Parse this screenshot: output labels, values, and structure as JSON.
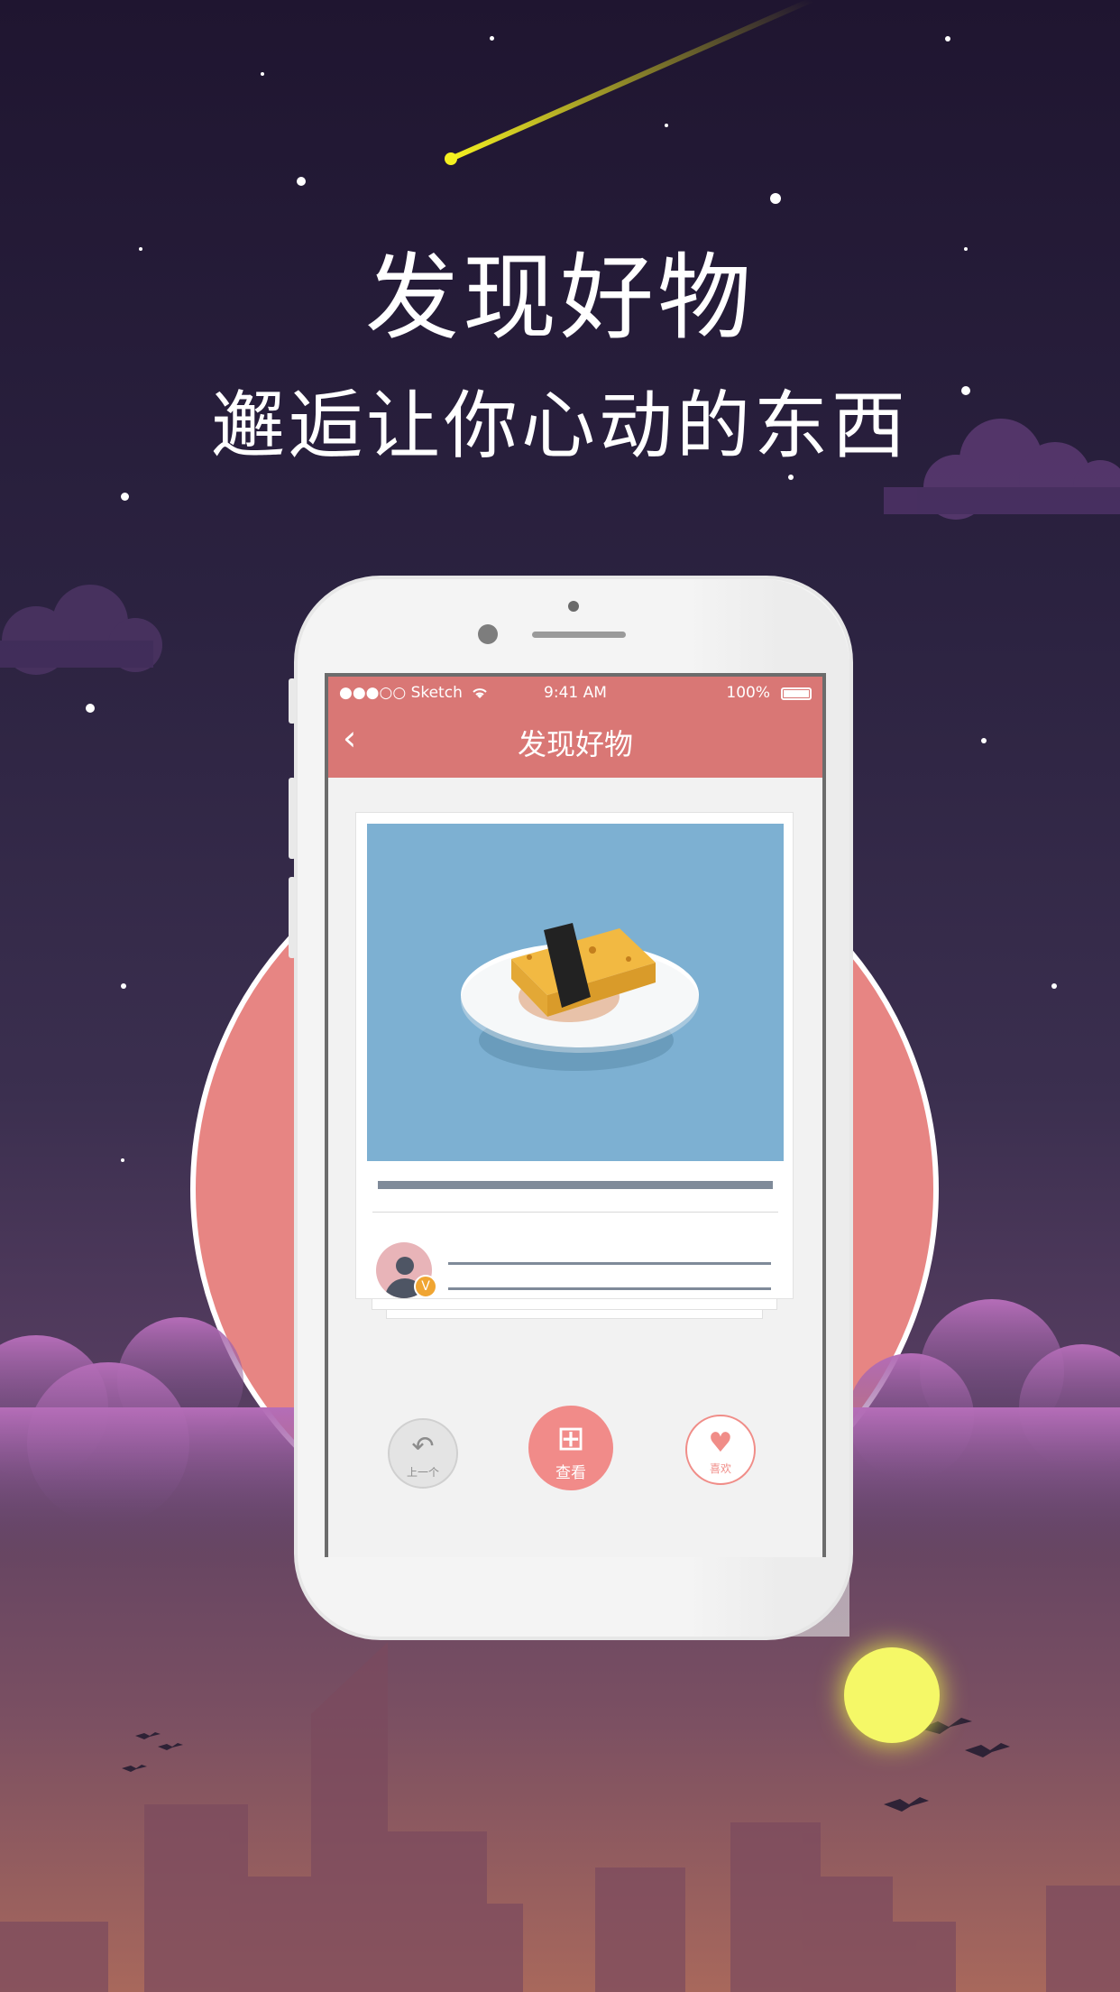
{
  "promo": {
    "title": "发现好物",
    "subtitle": "邂逅让你心动的东西"
  },
  "status_bar": {
    "carrier": "●●●○○ Sketch",
    "time": "9:41 AM",
    "battery": "100%"
  },
  "nav": {
    "title": "发现好物",
    "back_icon": "chevron-left-icon"
  },
  "actions": {
    "prev_label": "上一个",
    "view_label": "查看",
    "like_label": "喜欢"
  },
  "badge": "V",
  "colors": {
    "accent": "#d97775",
    "button_pink": "#f18b89",
    "image_bg": "#7db0d2",
    "moon": "#f5f867"
  }
}
